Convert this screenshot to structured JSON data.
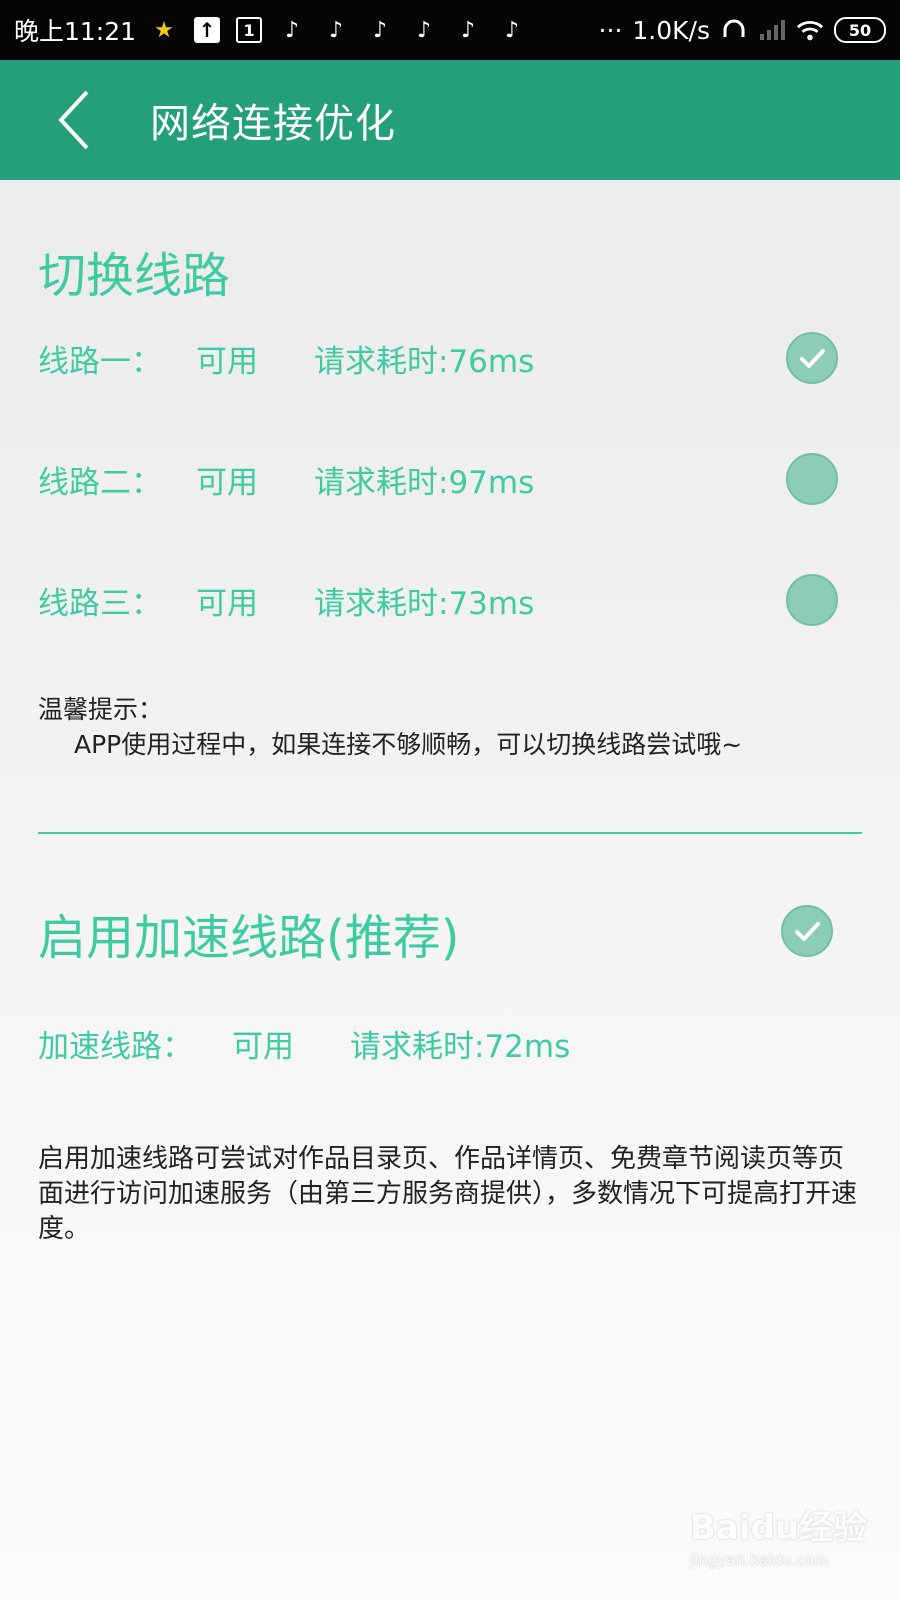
{
  "status_bar": {
    "time": "晚上11:21",
    "sim_indicator": "1",
    "more": "···",
    "net_speed": "1.0K/s",
    "battery": "50"
  },
  "header": {
    "title": "网络连接优化"
  },
  "switch_section": {
    "title": "切换线路",
    "routes": [
      {
        "name": "线路一：",
        "status": "可用",
        "latency": "请求耗时:76ms",
        "selected": true
      },
      {
        "name": "线路二：",
        "status": "可用",
        "latency": "请求耗时:97ms",
        "selected": false
      },
      {
        "name": "线路三：",
        "status": "可用",
        "latency": "请求耗时:73ms",
        "selected": false
      }
    ],
    "tip_label": "温馨提示：",
    "tip_text": "APP使用过程中，如果连接不够顺畅，可以切换线路尝试哦~"
  },
  "accel_section": {
    "title": "启用加速线路(推荐)",
    "enabled": true,
    "route": {
      "name": "加速线路：",
      "status": "可用",
      "latency": "请求耗时:72ms"
    },
    "description": "启用加速线路可尝试对作品目录页、作品详情页、免费章节阅读页等页面进行访问加速服务（由第三方服务商提供），多数情况下可提高打开速度。"
  },
  "watermark": {
    "logo": "Baidu经验",
    "url": "jingyan.baidu.com"
  },
  "colors": {
    "header_bg": "#23a07a",
    "accent_text": "#3fcba0",
    "radio_fill": "#8ccdb6",
    "divider": "#44c79c"
  }
}
